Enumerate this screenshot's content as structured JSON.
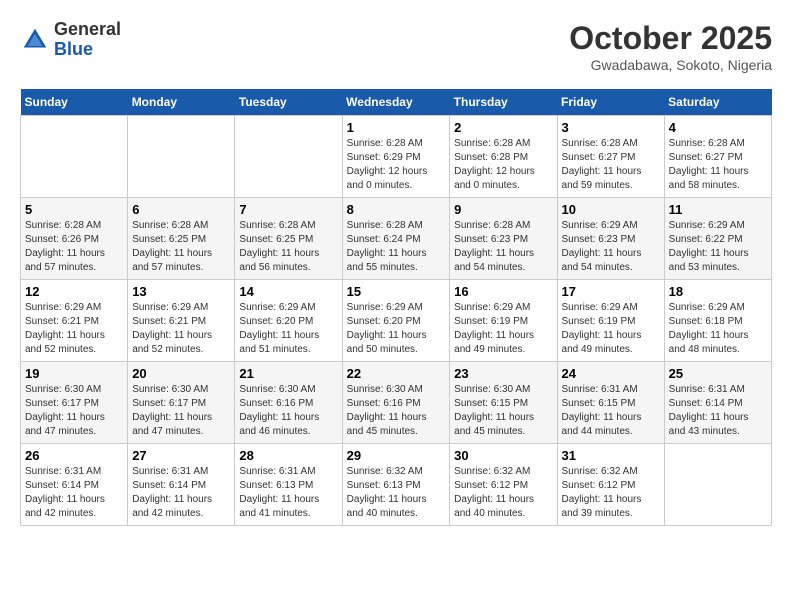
{
  "header": {
    "logo_general": "General",
    "logo_blue": "Blue",
    "month_title": "October 2025",
    "location": "Gwadabawa, Sokoto, Nigeria"
  },
  "days_of_week": [
    "Sunday",
    "Monday",
    "Tuesday",
    "Wednesday",
    "Thursday",
    "Friday",
    "Saturday"
  ],
  "weeks": [
    [
      {
        "day": "",
        "info": ""
      },
      {
        "day": "",
        "info": ""
      },
      {
        "day": "",
        "info": ""
      },
      {
        "day": "1",
        "info": "Sunrise: 6:28 AM\nSunset: 6:29 PM\nDaylight: 12 hours\nand 0 minutes."
      },
      {
        "day": "2",
        "info": "Sunrise: 6:28 AM\nSunset: 6:28 PM\nDaylight: 12 hours\nand 0 minutes."
      },
      {
        "day": "3",
        "info": "Sunrise: 6:28 AM\nSunset: 6:27 PM\nDaylight: 11 hours\nand 59 minutes."
      },
      {
        "day": "4",
        "info": "Sunrise: 6:28 AM\nSunset: 6:27 PM\nDaylight: 11 hours\nand 58 minutes."
      }
    ],
    [
      {
        "day": "5",
        "info": "Sunrise: 6:28 AM\nSunset: 6:26 PM\nDaylight: 11 hours\nand 57 minutes."
      },
      {
        "day": "6",
        "info": "Sunrise: 6:28 AM\nSunset: 6:25 PM\nDaylight: 11 hours\nand 57 minutes."
      },
      {
        "day": "7",
        "info": "Sunrise: 6:28 AM\nSunset: 6:25 PM\nDaylight: 11 hours\nand 56 minutes."
      },
      {
        "day": "8",
        "info": "Sunrise: 6:28 AM\nSunset: 6:24 PM\nDaylight: 11 hours\nand 55 minutes."
      },
      {
        "day": "9",
        "info": "Sunrise: 6:28 AM\nSunset: 6:23 PM\nDaylight: 11 hours\nand 54 minutes."
      },
      {
        "day": "10",
        "info": "Sunrise: 6:29 AM\nSunset: 6:23 PM\nDaylight: 11 hours\nand 54 minutes."
      },
      {
        "day": "11",
        "info": "Sunrise: 6:29 AM\nSunset: 6:22 PM\nDaylight: 11 hours\nand 53 minutes."
      }
    ],
    [
      {
        "day": "12",
        "info": "Sunrise: 6:29 AM\nSunset: 6:21 PM\nDaylight: 11 hours\nand 52 minutes."
      },
      {
        "day": "13",
        "info": "Sunrise: 6:29 AM\nSunset: 6:21 PM\nDaylight: 11 hours\nand 52 minutes."
      },
      {
        "day": "14",
        "info": "Sunrise: 6:29 AM\nSunset: 6:20 PM\nDaylight: 11 hours\nand 51 minutes."
      },
      {
        "day": "15",
        "info": "Sunrise: 6:29 AM\nSunset: 6:20 PM\nDaylight: 11 hours\nand 50 minutes."
      },
      {
        "day": "16",
        "info": "Sunrise: 6:29 AM\nSunset: 6:19 PM\nDaylight: 11 hours\nand 49 minutes."
      },
      {
        "day": "17",
        "info": "Sunrise: 6:29 AM\nSunset: 6:19 PM\nDaylight: 11 hours\nand 49 minutes."
      },
      {
        "day": "18",
        "info": "Sunrise: 6:29 AM\nSunset: 6:18 PM\nDaylight: 11 hours\nand 48 minutes."
      }
    ],
    [
      {
        "day": "19",
        "info": "Sunrise: 6:30 AM\nSunset: 6:17 PM\nDaylight: 11 hours\nand 47 minutes."
      },
      {
        "day": "20",
        "info": "Sunrise: 6:30 AM\nSunset: 6:17 PM\nDaylight: 11 hours\nand 47 minutes."
      },
      {
        "day": "21",
        "info": "Sunrise: 6:30 AM\nSunset: 6:16 PM\nDaylight: 11 hours\nand 46 minutes."
      },
      {
        "day": "22",
        "info": "Sunrise: 6:30 AM\nSunset: 6:16 PM\nDaylight: 11 hours\nand 45 minutes."
      },
      {
        "day": "23",
        "info": "Sunrise: 6:30 AM\nSunset: 6:15 PM\nDaylight: 11 hours\nand 45 minutes."
      },
      {
        "day": "24",
        "info": "Sunrise: 6:31 AM\nSunset: 6:15 PM\nDaylight: 11 hours\nand 44 minutes."
      },
      {
        "day": "25",
        "info": "Sunrise: 6:31 AM\nSunset: 6:14 PM\nDaylight: 11 hours\nand 43 minutes."
      }
    ],
    [
      {
        "day": "26",
        "info": "Sunrise: 6:31 AM\nSunset: 6:14 PM\nDaylight: 11 hours\nand 42 minutes."
      },
      {
        "day": "27",
        "info": "Sunrise: 6:31 AM\nSunset: 6:14 PM\nDaylight: 11 hours\nand 42 minutes."
      },
      {
        "day": "28",
        "info": "Sunrise: 6:31 AM\nSunset: 6:13 PM\nDaylight: 11 hours\nand 41 minutes."
      },
      {
        "day": "29",
        "info": "Sunrise: 6:32 AM\nSunset: 6:13 PM\nDaylight: 11 hours\nand 40 minutes."
      },
      {
        "day": "30",
        "info": "Sunrise: 6:32 AM\nSunset: 6:12 PM\nDaylight: 11 hours\nand 40 minutes."
      },
      {
        "day": "31",
        "info": "Sunrise: 6:32 AM\nSunset: 6:12 PM\nDaylight: 11 hours\nand 39 minutes."
      },
      {
        "day": "",
        "info": ""
      }
    ]
  ]
}
